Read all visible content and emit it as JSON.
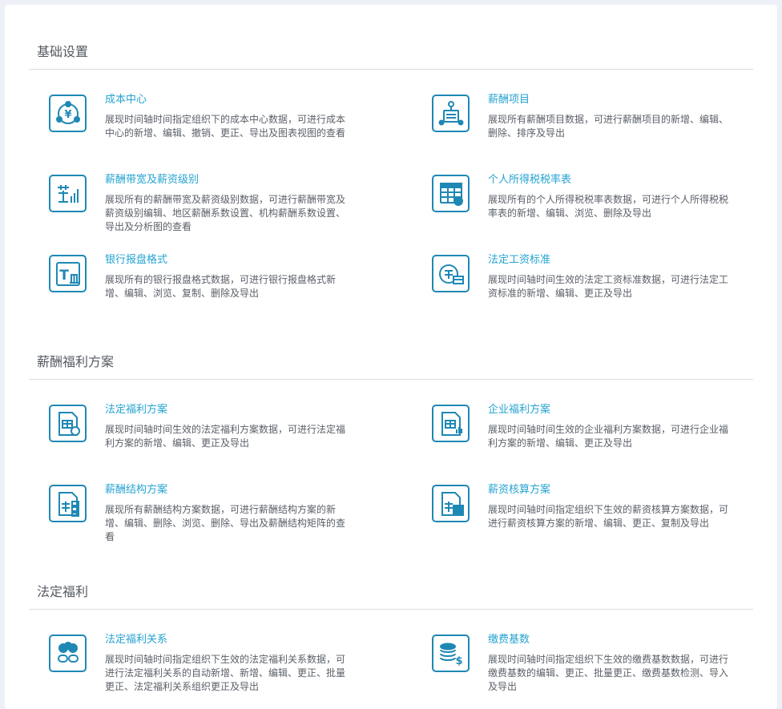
{
  "sections": [
    {
      "title": "基础设置",
      "items": [
        {
          "title": "成本中心",
          "desc": "展现时间轴时间指定组织下的成本中心数据，可进行成本中心的新增、编辑、撤销、更正、导出及图表视图的查看",
          "icon": "cost-center-icon"
        },
        {
          "title": "薪酬项目",
          "desc": "展现所有薪酬项目数据，可进行薪酬项目的新增、编辑、删除、排序及导出",
          "icon": "salary-item-icon"
        },
        {
          "title": "薪酬带宽及薪资级别",
          "desc": "展现所有的薪酬带宽及薪资级别数据，可进行薪酬带宽及薪资级别编辑、地区薪酬系数设置、机构薪酬系数设置、导出及分析图的查看",
          "icon": "salary-band-icon"
        },
        {
          "title": "个人所得税税率表",
          "desc": "展现所有的个人所得税税率表数据，可进行个人所得税税率表的新增、编辑、浏览、删除及导出",
          "icon": "tax-table-icon"
        },
        {
          "title": "银行报盘格式",
          "desc": "展现所有的银行报盘格式数据，可进行银行报盘格式新增、编辑、浏览、复制、删除及导出",
          "icon": "bank-format-icon"
        },
        {
          "title": "法定工资标准",
          "desc": "展现时间轴时间生效的法定工资标准数据，可进行法定工资标准的新增、编辑、更正及导出",
          "icon": "wage-standard-icon"
        }
      ]
    },
    {
      "title": "薪酬福利方案",
      "items": [
        {
          "title": "法定福利方案",
          "desc": "展现时间轴时间生效的法定福利方案数据，可进行法定福利方案的新增、编辑、更正及导出",
          "icon": "statutory-benefit-plan-icon"
        },
        {
          "title": "企业福利方案",
          "desc": "展现时间轴时间生效的企业福利方案数据，可进行企业福利方案的新增、编辑、更正及导出",
          "icon": "enterprise-benefit-plan-icon"
        },
        {
          "title": "薪酬结构方案",
          "desc": "展现所有薪酬结构方案数据，可进行薪酬结构方案的新增、编辑、删除、浏览、删除、导出及薪酬结构矩阵的查看",
          "icon": "salary-structure-icon"
        },
        {
          "title": "薪资核算方案",
          "desc": "展现时间轴时间指定组织下生效的薪资核算方案数据，可进行薪资核算方案的新增、编辑、更正、复制及导出",
          "icon": "payroll-calc-icon"
        }
      ]
    },
    {
      "title": "法定福利",
      "items": [
        {
          "title": "法定福利关系",
          "desc": "展现时间轴时间指定组织下生效的法定福利关系数据，可进行法定福利关系的自动新增、新增、编辑、更正、批量更正、法定福利关系组织更正及导出",
          "icon": "benefit-relation-icon"
        },
        {
          "title": "缴费基数",
          "desc": "展现时间轴时间指定组织下生效的缴费基数数据，可进行缴费基数的编辑、更正、批量更正、缴费基数检测、导入及导出",
          "icon": "contribution-base-icon"
        }
      ]
    }
  ],
  "colors": {
    "accent": "#1e88b4",
    "title_link": "#25a3d1",
    "text": "#5b6068"
  }
}
